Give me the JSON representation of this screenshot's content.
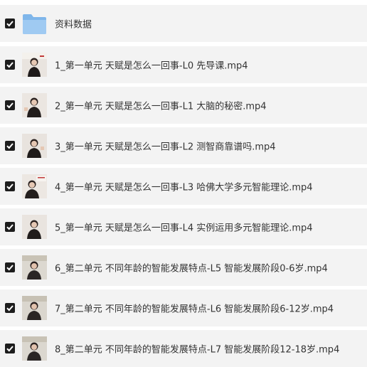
{
  "files": [
    {
      "name": "资料数据",
      "type": "folder",
      "checked": true
    },
    {
      "name": "1_第一单元 天赋是怎么一回事-L0 先导课.mp4",
      "type": "video",
      "checked": true
    },
    {
      "name": "2_第一单元 天赋是怎么一回事-L1 大脑的秘密.mp4",
      "type": "video",
      "checked": true
    },
    {
      "name": "3_第一单元 天赋是怎么一回事-L2 测智商靠谱吗.mp4",
      "type": "video",
      "checked": true
    },
    {
      "name": "4_第一单元 天赋是怎么一回事-L3 哈佛大学多元智能理论.mp4",
      "type": "video",
      "checked": true
    },
    {
      "name": "5_第一单元 天赋是怎么一回事-L4 实例运用多元智能理论.mp4",
      "type": "video",
      "checked": true
    },
    {
      "name": "6_第二单元 不同年龄的智能发展特点-L5 智能发展阶段0-6岁.mp4",
      "type": "video",
      "checked": true
    },
    {
      "name": "7_第二单元 不同年龄的智能发展特点-L6 智能发展阶段6-12岁.mp4",
      "type": "video",
      "checked": true
    },
    {
      "name": "8_第二单元 不同年龄的智能发展特点-L7 智能发展阶段12-18岁.mp4",
      "type": "video",
      "checked": true
    }
  ],
  "colors": {
    "row_bg": "#f3f3f3",
    "checkbox": "#1d1d1d",
    "folder": "#7fb6ea"
  }
}
